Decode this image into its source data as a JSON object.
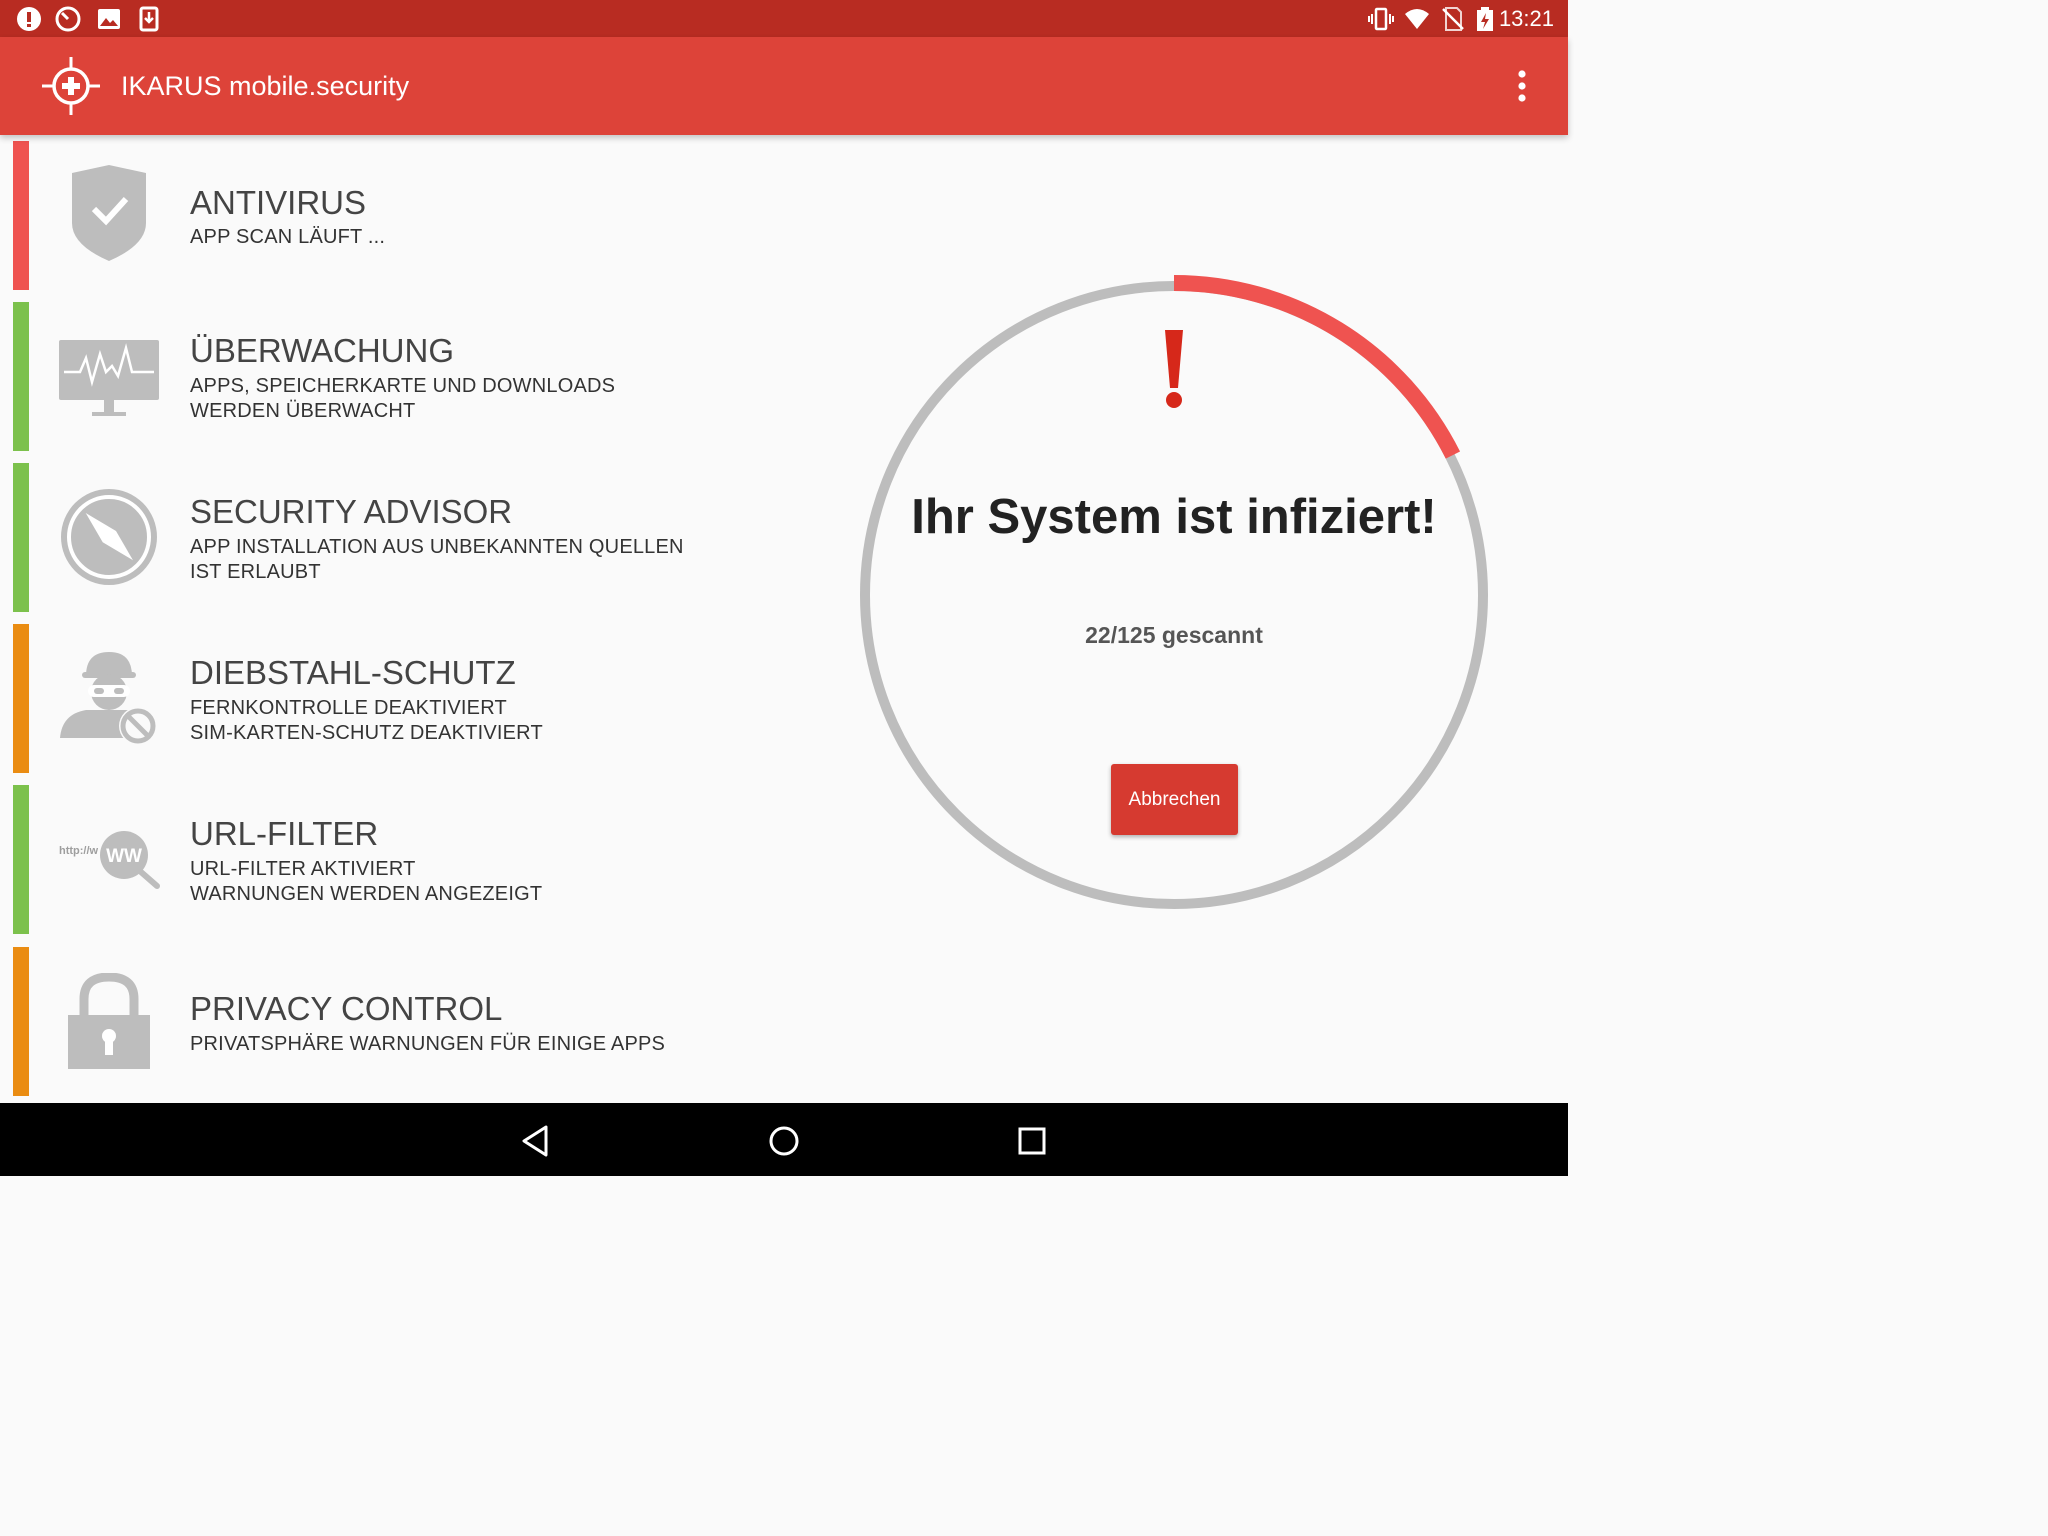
{
  "status_bar": {
    "time": "13:21",
    "left_icons": [
      "alert-icon",
      "clock-icon",
      "image-icon",
      "download-icon"
    ],
    "right_icons": [
      "vibrate-icon",
      "wifi-icon",
      "no-sim-icon",
      "battery-charging-icon"
    ]
  },
  "app_bar": {
    "title": "IKARUS mobile.security",
    "logo_icon": "ikarus-crosshair-logo",
    "menu_icon": "more-vert-icon"
  },
  "modules": [
    {
      "title": "ANTIVIRUS",
      "lines": [
        "APP SCAN LÄUFT ..."
      ],
      "status_color": "#ef5350",
      "icon": "shield-check-icon"
    },
    {
      "title": "ÜBERWACHUNG",
      "lines": [
        "APPS, SPEICHERKARTE UND DOWNLOADS",
        "WERDEN ÜBERWACHT"
      ],
      "status_color": "#7cc14c",
      "icon": "monitor-pulse-icon"
    },
    {
      "title": "SECURITY ADVISOR",
      "lines": [
        "APP INSTALLATION AUS UNBEKANNTEN QUELLEN",
        "IST ERLAUBT"
      ],
      "status_color": "#7cc14c",
      "icon": "compass-icon"
    },
    {
      "title": "DIEBSTAHL-SCHUTZ",
      "lines": [
        "FERNKONTROLLE DEAKTIVIERT",
        "SIM-KARTEN-SCHUTZ DEAKTIVIERT"
      ],
      "status_color": "#ea8c12",
      "icon": "thief-blocked-icon"
    },
    {
      "title": "URL-FILTER",
      "lines": [
        "URL-FILTER AKTIVIERT",
        "WARNUNGEN WERDEN ANGEZEIGT"
      ],
      "status_color": "#7cc14c",
      "icon": "url-search-icon"
    },
    {
      "title": "PRIVACY CONTROL",
      "lines": [
        "PRIVATSPHÄRE WARNUNGEN FÜR EINIGE APPS"
      ],
      "status_color": "#ea8c12",
      "icon": "padlock-icon"
    }
  ],
  "url_icon_text": {
    "prefix": "http://w",
    "bubble": "WW"
  },
  "scan": {
    "headline": "Ihr System ist infiziert!",
    "progress_text": "22/125 gescannt",
    "scanned": 22,
    "total": 125,
    "cancel_label": "Abbrechen",
    "alert_icon": "exclamation-icon",
    "accent_color": "#ef5350",
    "alert_color": "#d6281a",
    "track_color": "#bdbdbd"
  },
  "nav_bar": {
    "icons": [
      "back-icon",
      "home-icon",
      "recents-icon"
    ]
  }
}
